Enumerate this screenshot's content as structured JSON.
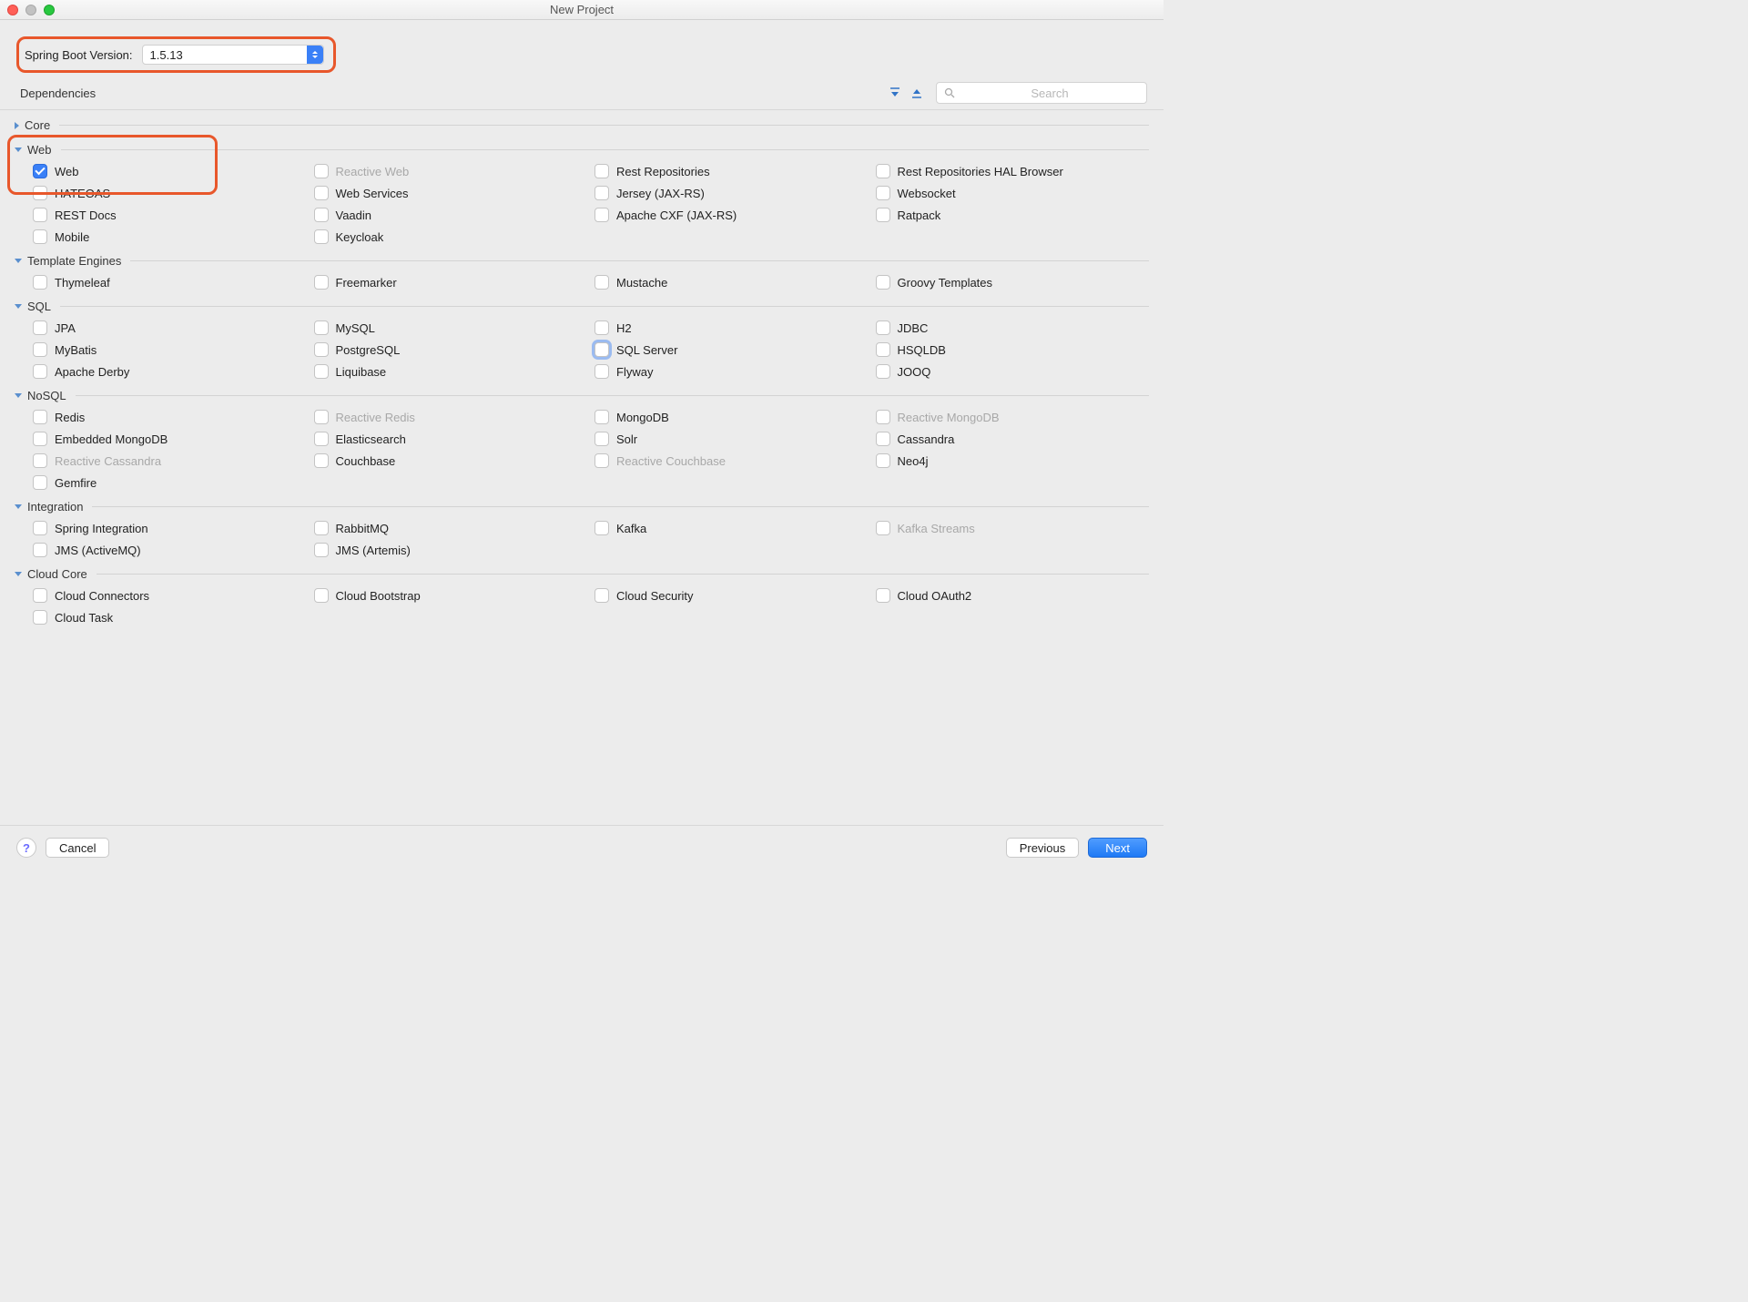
{
  "window": {
    "title": "New Project"
  },
  "search_placeholder": "Search",
  "version": {
    "label": "Spring Boot Version:",
    "selected": "1.5.13"
  },
  "dep_header": "Dependencies",
  "buttons": {
    "help_tooltip": "?",
    "cancel": "Cancel",
    "previous": "Previous",
    "next": "Next"
  },
  "categories": [
    {
      "name": "Core",
      "expanded": false,
      "items": []
    },
    {
      "name": "Web",
      "expanded": true,
      "highlight": true,
      "items": [
        {
          "label": "Web",
          "checked": true
        },
        {
          "label": "Reactive Web",
          "disabled": true
        },
        {
          "label": "Rest Repositories"
        },
        {
          "label": "Rest Repositories HAL Browser"
        },
        {
          "label": "HATEOAS"
        },
        {
          "label": "Web Services"
        },
        {
          "label": "Jersey (JAX-RS)"
        },
        {
          "label": "Websocket"
        },
        {
          "label": "REST Docs"
        },
        {
          "label": "Vaadin"
        },
        {
          "label": "Apache CXF (JAX-RS)"
        },
        {
          "label": "Ratpack"
        },
        {
          "label": "Mobile"
        },
        {
          "label": "Keycloak"
        }
      ]
    },
    {
      "name": "Template Engines",
      "expanded": true,
      "items": [
        {
          "label": "Thymeleaf"
        },
        {
          "label": "Freemarker"
        },
        {
          "label": "Mustache"
        },
        {
          "label": "Groovy Templates"
        }
      ]
    },
    {
      "name": "SQL",
      "expanded": true,
      "items": [
        {
          "label": "JPA"
        },
        {
          "label": "MySQL"
        },
        {
          "label": "H2"
        },
        {
          "label": "JDBC"
        },
        {
          "label": "MyBatis"
        },
        {
          "label": "PostgreSQL"
        },
        {
          "label": "SQL Server",
          "focused": true
        },
        {
          "label": "HSQLDB"
        },
        {
          "label": "Apache Derby"
        },
        {
          "label": "Liquibase"
        },
        {
          "label": "Flyway"
        },
        {
          "label": "JOOQ"
        }
      ]
    },
    {
      "name": "NoSQL",
      "expanded": true,
      "items": [
        {
          "label": "Redis"
        },
        {
          "label": "Reactive Redis",
          "disabled": true
        },
        {
          "label": "MongoDB"
        },
        {
          "label": "Reactive MongoDB",
          "disabled": true
        },
        {
          "label": "Embedded MongoDB"
        },
        {
          "label": "Elasticsearch"
        },
        {
          "label": "Solr"
        },
        {
          "label": "Cassandra"
        },
        {
          "label": "Reactive Cassandra",
          "disabled": true
        },
        {
          "label": "Couchbase"
        },
        {
          "label": "Reactive Couchbase",
          "disabled": true
        },
        {
          "label": "Neo4j"
        },
        {
          "label": "Gemfire"
        }
      ]
    },
    {
      "name": "Integration",
      "expanded": true,
      "items": [
        {
          "label": "Spring Integration"
        },
        {
          "label": "RabbitMQ"
        },
        {
          "label": "Kafka"
        },
        {
          "label": "Kafka Streams",
          "disabled": true
        },
        {
          "label": "JMS (ActiveMQ)"
        },
        {
          "label": "JMS (Artemis)"
        }
      ]
    },
    {
      "name": "Cloud Core",
      "expanded": true,
      "items": [
        {
          "label": "Cloud Connectors"
        },
        {
          "label": "Cloud Bootstrap"
        },
        {
          "label": "Cloud Security"
        },
        {
          "label": "Cloud OAuth2"
        },
        {
          "label": "Cloud Task"
        }
      ]
    }
  ]
}
